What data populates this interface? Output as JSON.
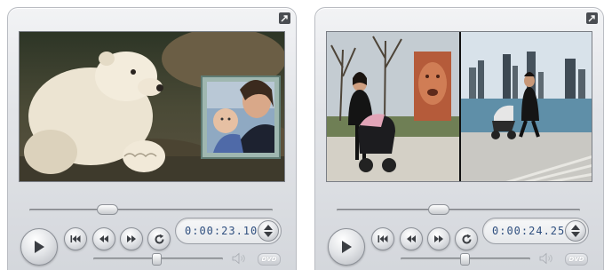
{
  "players": [
    {
      "timecode": "0:00:23.10",
      "scrub_position": 0.31,
      "volume_level": 0.5,
      "dvd_label": "DVD",
      "screen_content": "polar bear with picture-in-picture of mother and baby"
    },
    {
      "timecode": "0:00:24.25",
      "scrub_position": 0.5,
      "volume_level": 0.51,
      "dvd_label": "DVD",
      "screen_content": "split-screen: woman with stroller in park and woman with stroller on lakeside path"
    }
  ],
  "icons": {
    "detach": "detach-arrow-icon",
    "play": "play-icon",
    "prev": "skip-back-icon",
    "rewind": "rewind-icon",
    "forward": "fast-forward-icon",
    "loop": "loop-icon",
    "speaker": "speaker-icon"
  },
  "colors": {
    "timecode_text": "#2f4f7f",
    "button_glyph": "#3b3e43"
  }
}
